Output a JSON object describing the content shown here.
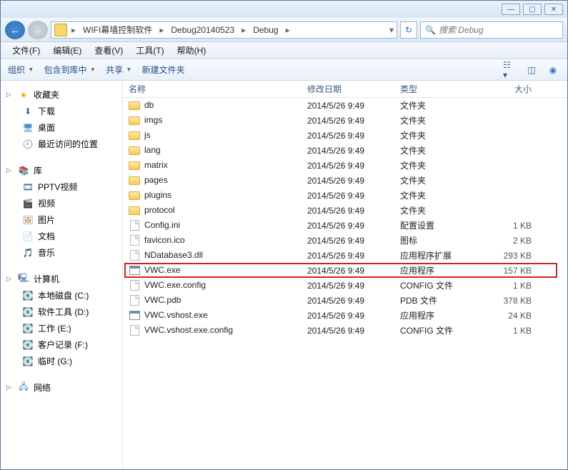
{
  "titlebar": {
    "min": "—",
    "max": "▢",
    "close": "✕"
  },
  "nav": {
    "back": "←",
    "fwd": "→",
    "refresh": "↻"
  },
  "breadcrumb": [
    {
      "label": "WIFI幕墙控制软件"
    },
    {
      "label": "Debug20140523"
    },
    {
      "label": "Debug"
    }
  ],
  "search": {
    "placeholder": "搜索 Debug",
    "icon": "🔍"
  },
  "menubar": [
    {
      "label": "文件(F)"
    },
    {
      "label": "编辑(E)"
    },
    {
      "label": "查看(V)"
    },
    {
      "label": "工具(T)"
    },
    {
      "label": "帮助(H)"
    }
  ],
  "toolbar": {
    "organize": "组织",
    "include": "包含到库中",
    "share": "共享",
    "newfolder": "新建文件夹"
  },
  "sidebar": {
    "favorites": {
      "label": "收藏夹",
      "items": [
        {
          "label": "下载",
          "icon": "⬇"
        },
        {
          "label": "桌面",
          "icon": "🖥"
        },
        {
          "label": "最近访问的位置",
          "icon": "🕘"
        }
      ]
    },
    "libraries": {
      "label": "库",
      "items": [
        {
          "label": "PPTV视频",
          "icon": "🎞"
        },
        {
          "label": "视频",
          "icon": "🎬"
        },
        {
          "label": "图片",
          "icon": "🖼"
        },
        {
          "label": "文档",
          "icon": "📄"
        },
        {
          "label": "音乐",
          "icon": "🎵"
        }
      ]
    },
    "computer": {
      "label": "计算机",
      "items": [
        {
          "label": "本地磁盘 (C:)",
          "icon": "💽"
        },
        {
          "label": "软件工具 (D:)",
          "icon": "💽"
        },
        {
          "label": "工作 (E:)",
          "icon": "💽"
        },
        {
          "label": "客户记录 (F:)",
          "icon": "💽"
        },
        {
          "label": "临时 (G:)",
          "icon": "💽"
        }
      ]
    },
    "network": {
      "label": "网络"
    }
  },
  "columns": {
    "name": "名称",
    "date": "修改日期",
    "type": "类型",
    "size": "大小"
  },
  "files": [
    {
      "name": "db",
      "date": "2014/5/26 9:49",
      "type": "文件夹",
      "size": "",
      "kind": "folder"
    },
    {
      "name": "imgs",
      "date": "2014/5/26 9:49",
      "type": "文件夹",
      "size": "",
      "kind": "folder"
    },
    {
      "name": "js",
      "date": "2014/5/26 9:49",
      "type": "文件夹",
      "size": "",
      "kind": "folder"
    },
    {
      "name": "lang",
      "date": "2014/5/26 9:49",
      "type": "文件夹",
      "size": "",
      "kind": "folder"
    },
    {
      "name": "matrix",
      "date": "2014/5/26 9:49",
      "type": "文件夹",
      "size": "",
      "kind": "folder"
    },
    {
      "name": "pages",
      "date": "2014/5/26 9:49",
      "type": "文件夹",
      "size": "",
      "kind": "folder"
    },
    {
      "name": "plugins",
      "date": "2014/5/26 9:49",
      "type": "文件夹",
      "size": "",
      "kind": "folder"
    },
    {
      "name": "protocol",
      "date": "2014/5/26 9:49",
      "type": "文件夹",
      "size": "",
      "kind": "folder"
    },
    {
      "name": "Config.ini",
      "date": "2014/5/26 9:49",
      "type": "配置设置",
      "size": "1 KB",
      "kind": "doc"
    },
    {
      "name": "favicon.ico",
      "date": "2014/5/26 9:49",
      "type": "图标",
      "size": "2 KB",
      "kind": "doc"
    },
    {
      "name": "NDatabase3.dll",
      "date": "2014/5/26 9:49",
      "type": "应用程序扩展",
      "size": "293 KB",
      "kind": "doc"
    },
    {
      "name": "VWC.exe",
      "date": "2014/5/26 9:49",
      "type": "应用程序",
      "size": "157 KB",
      "kind": "exe",
      "highlighted": true
    },
    {
      "name": "VWC.exe.config",
      "date": "2014/5/26 9:49",
      "type": "CONFIG 文件",
      "size": "1 KB",
      "kind": "doc"
    },
    {
      "name": "VWC.pdb",
      "date": "2014/5/26 9:49",
      "type": "PDB 文件",
      "size": "378 KB",
      "kind": "doc"
    },
    {
      "name": "VWC.vshost.exe",
      "date": "2014/5/26 9:49",
      "type": "应用程序",
      "size": "24 KB",
      "kind": "exe"
    },
    {
      "name": "VWC.vshost.exe.config",
      "date": "2014/5/26 9:49",
      "type": "CONFIG 文件",
      "size": "1 KB",
      "kind": "doc"
    }
  ]
}
